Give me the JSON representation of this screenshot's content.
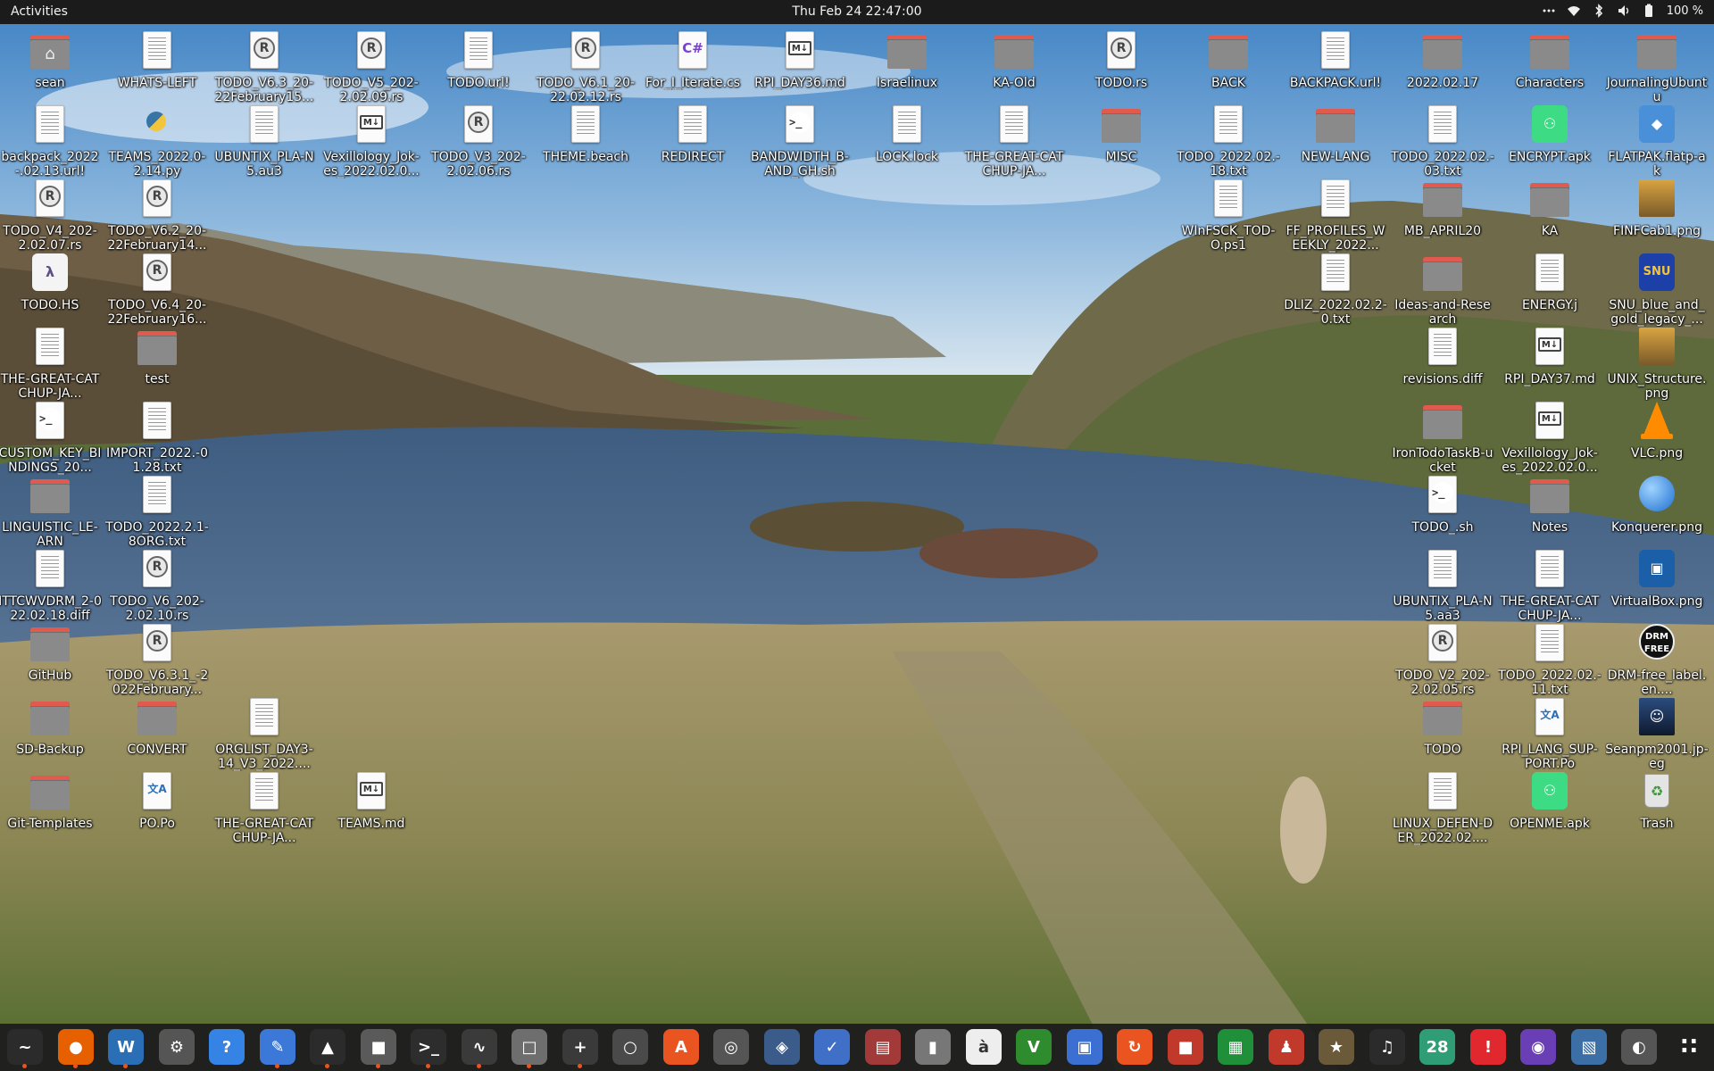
{
  "topbar": {
    "activities": "Activities",
    "clock": "Thu Feb 24  22:47:00",
    "battery": "100 %",
    "tray_icons": [
      "menu-dots-icon",
      "wifi-icon",
      "bluetooth-icon",
      "volume-icon",
      "battery-icon"
    ]
  },
  "desktop": {
    "icons": [
      {
        "label": "sean",
        "type": "home-folder"
      },
      {
        "label": "WHATS-LEFT",
        "type": "doc"
      },
      {
        "label": "TODO_V6.3_20-22February15...",
        "type": "rust"
      },
      {
        "label": "TODO_V5_202-2.02.09.rs",
        "type": "rust"
      },
      {
        "label": "TODO.url!",
        "type": "doc"
      },
      {
        "label": "TODO_V6.1_20-22.02.12.rs",
        "type": "rust"
      },
      {
        "label": "For_I_Iterate.cs",
        "type": "csharp"
      },
      {
        "label": "RPI_DAY36.md",
        "type": "markdown"
      },
      {
        "label": "Israelinux",
        "type": "folder"
      },
      {
        "label": "KA-Old",
        "type": "folder"
      },
      {
        "label": "TODO.rs",
        "type": "rust"
      },
      {
        "label": "BACK",
        "type": "folder"
      },
      {
        "label": "BACKPACK.url!",
        "type": "doc"
      },
      {
        "label": "2022.02.17",
        "type": "folder"
      },
      {
        "label": "Characters",
        "type": "folder"
      },
      {
        "label": "JournalingUbuntu",
        "type": "folder"
      },
      {
        "label": "backpack_2022-.02.13.url!",
        "type": "doc"
      },
      {
        "label": "TEAMS_2022.0-2.14.py",
        "type": "python"
      },
      {
        "label": "UBUNTIX_PLA-N5.au3",
        "type": "doc"
      },
      {
        "label": "Vexillology_Jok-es_2022.02.0...",
        "type": "markdown"
      },
      {
        "label": "TODO_V3_202-2.02.06.rs",
        "type": "rust"
      },
      {
        "label": "THEME.beach",
        "type": "doc"
      },
      {
        "label": "REDIRECT",
        "type": "doc"
      },
      {
        "label": "BANDWIDTH_B-AND_GH.sh",
        "type": "script"
      },
      {
        "label": "LOCK.lock",
        "type": "doc"
      },
      {
        "label": "THE-GREAT-CATCHUP-JA...",
        "type": "doc"
      },
      {
        "label": "MISC",
        "type": "folder"
      },
      {
        "label": "TODO_2022.02.-18.txt",
        "type": "doc"
      },
      {
        "label": "NEW-LANG",
        "type": "folder"
      },
      {
        "label": "TODO_2022.02.-03.txt",
        "type": "doc"
      },
      {
        "label": "ENCRYPT.apk",
        "type": "apk"
      },
      {
        "label": "FLATPAK.flatp-ak",
        "type": "flatpak"
      },
      {
        "label": "TODO_V4_202-2.02.07.rs",
        "type": "rust"
      },
      {
        "label": "TODO_V6.2_20-22February14...",
        "type": "rust"
      },
      {
        "label": "WInFSCK_TOD-O.ps1",
        "type": "doc"
      },
      {
        "label": "FF_PROFILES_WEEKLY_2022...",
        "type": "doc"
      },
      {
        "label": "MB_APRIL20",
        "type": "folder"
      },
      {
        "label": "KA",
        "type": "folder"
      },
      {
        "label": "FINFCab1.png",
        "type": "image"
      },
      {
        "label": "TODO.HS",
        "type": "haskell"
      },
      {
        "label": "TODO_V6.4_20-22February16...",
        "type": "rust"
      },
      {
        "label": "DLIZ_2022.02.2-0.txt",
        "type": "doc"
      },
      {
        "label": "Ideas-and-Research",
        "type": "folder"
      },
      {
        "label": "ENERGY.j",
        "type": "doc"
      },
      {
        "label": "SNU_blue_and_gold_legacy_...",
        "type": "snu"
      },
      {
        "label": "THE-GREAT-CATCHUP-JA...",
        "type": "doc"
      },
      {
        "label": "test",
        "type": "folder"
      },
      {
        "label": "revisions.diff",
        "type": "doc"
      },
      {
        "label": "RPI_DAY37.md",
        "type": "markdown"
      },
      {
        "label": "UNIX_Structure.png",
        "type": "image"
      },
      {
        "label": "CUSTOM_KEY_BINDINGS_20...",
        "type": "script"
      },
      {
        "label": "IMPORT_2022.-01.28.txt",
        "type": "doc"
      },
      {
        "label": "IronTodoTaskB-ucket",
        "type": "folder"
      },
      {
        "label": "Vexillology_Jok-es_2022.02.0...",
        "type": "markdown"
      },
      {
        "label": "VLC.png",
        "type": "vlc"
      },
      {
        "label": "LINGUISTIC_LE-ARN",
        "type": "folder"
      },
      {
        "label": "TODO_2022.2.1-8ORG.txt",
        "type": "doc"
      },
      {
        "label": "TODO_.sh",
        "type": "script"
      },
      {
        "label": "Notes",
        "type": "folder"
      },
      {
        "label": "Konquerer.png",
        "type": "globe"
      },
      {
        "label": "ITTCWVDRM_2-022.02.18.diff",
        "type": "doc"
      },
      {
        "label": "TODO_V6_202-2.02.10.rs",
        "type": "rust"
      },
      {
        "label": "UBUNTIX_PLA-N5.aa3",
        "type": "doc"
      },
      {
        "label": "THE-GREAT-CATCHUP-JA...",
        "type": "doc"
      },
      {
        "label": "VirtualBox.png",
        "type": "vbox"
      },
      {
        "label": "GitHub",
        "type": "folder"
      },
      {
        "label": "TODO_V6.3.1_-2022February...",
        "type": "rust"
      },
      {
        "label": "TODO_V2_202-2.02.05.rs",
        "type": "rust"
      },
      {
        "label": "TODO_2022.02.-11.txt",
        "type": "doc"
      },
      {
        "label": "DRM-free_label.en....",
        "type": "drm"
      },
      {
        "label": "SD-Backup",
        "type": "folder"
      },
      {
        "label": "CONVERT",
        "type": "folder"
      },
      {
        "label": "ORGLIST_DAY3-14_V3_2022....",
        "type": "doc"
      },
      {
        "label": "TODO",
        "type": "folder"
      },
      {
        "label": "RPI_LANG_SUP-PORT.Po",
        "type": "po"
      },
      {
        "label": "Seanpm2001.jp-eg",
        "type": "photo"
      },
      {
        "label": "Git-Templates",
        "type": "folder"
      },
      {
        "label": "PO.Po",
        "type": "po"
      },
      {
        "label": "THE-GREAT-CATCHUP-JA...",
        "type": "doc"
      },
      {
        "label": "TEAMS.md",
        "type": "markdown"
      },
      {
        "label": "LINUX_DEFEN-DER_2022.02....",
        "type": "doc"
      },
      {
        "label": "OPENME.apk",
        "type": "apk"
      },
      {
        "label": "Trash",
        "type": "trash"
      }
    ]
  },
  "dock": {
    "items": [
      {
        "name": "system-monitor",
        "color": "#2b2b2b",
        "glyph": "~"
      },
      {
        "name": "firefox",
        "color": "#e66000",
        "glyph": "●"
      },
      {
        "name": "libreoffice-writer",
        "color": "#2a6fb5",
        "glyph": "W"
      },
      {
        "name": "settings",
        "color": "#555555",
        "glyph": "⚙"
      },
      {
        "name": "help",
        "color": "#3583e4",
        "glyph": "?"
      },
      {
        "name": "text-editor",
        "color": "#3c78d8",
        "glyph": "✎"
      },
      {
        "name": "vlc",
        "color": "#2b2b2b",
        "glyph": "▲"
      },
      {
        "name": "puzzle",
        "color": "#5a5a5a",
        "glyph": "■"
      },
      {
        "name": "terminal",
        "color": "#2d2d2d",
        "glyph": ">_"
      },
      {
        "name": "resource-monitor",
        "color": "#3a3a3a",
        "glyph": "∿"
      },
      {
        "name": "files",
        "color": "#6e6e6e",
        "glyph": "□"
      },
      {
        "name": "calculator",
        "color": "#3a3a3a",
        "glyph": "+"
      },
      {
        "name": "image-viewer",
        "color": "#4a4a4a",
        "glyph": "○"
      },
      {
        "name": "software-center",
        "color": "#e95420",
        "glyph": "A"
      },
      {
        "name": "disk-utility",
        "color": "#555555",
        "glyph": "◎"
      },
      {
        "name": "screenshot",
        "color": "#3b5c8a",
        "glyph": "◈"
      },
      {
        "name": "todo",
        "color": "#3f6fc7",
        "glyph": "✓"
      },
      {
        "name": "document-scanner",
        "color": "#a33a3a",
        "glyph": "▤"
      },
      {
        "name": "archive-manager",
        "color": "#777777",
        "glyph": "▮"
      },
      {
        "name": "character-map",
        "color": "#eeeeee",
        "glyph": "à"
      },
      {
        "name": "vim",
        "color": "#2e8b2e",
        "glyph": "V"
      },
      {
        "name": "remote-desktop",
        "color": "#3b6fd1",
        "glyph": "▣"
      },
      {
        "name": "software-updater",
        "color": "#e95420",
        "glyph": "↻"
      },
      {
        "name": "pdf-viewer",
        "color": "#c0392b",
        "glyph": "■"
      },
      {
        "name": "libreoffice-calc",
        "color": "#1f8f3a",
        "glyph": "▦"
      },
      {
        "name": "game",
        "color": "#c0392b",
        "glyph": "♟"
      },
      {
        "name": "gimp",
        "color": "#6b5a3a",
        "glyph": "★"
      },
      {
        "name": "music",
        "color": "#2b2b2b",
        "glyph": "♫"
      },
      {
        "name": "calendar",
        "color": "#2f9e77",
        "glyph": "28"
      },
      {
        "name": "alert",
        "color": "#e0282e",
        "glyph": "!"
      },
      {
        "name": "camera",
        "color": "#6a3fb5",
        "glyph": "◉"
      },
      {
        "name": "photo-editor",
        "color": "#3b6fa5",
        "glyph": "▧"
      },
      {
        "name": "steam",
        "color": "#555555",
        "glyph": "◐"
      },
      {
        "name": "app-grid",
        "color": "transparent",
        "glyph": "∷"
      }
    ]
  }
}
